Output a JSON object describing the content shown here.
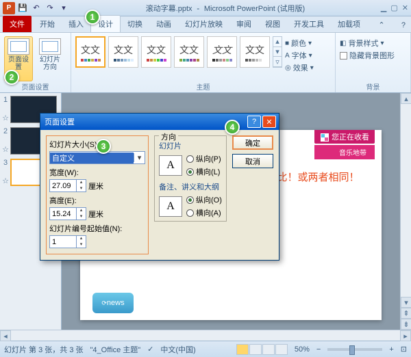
{
  "app": {
    "title_doc": "滚动字幕.pptx",
    "title_app": "Microsoft PowerPoint (试用版)"
  },
  "ribbon": {
    "tabs": {
      "file": "文件",
      "home": "开始",
      "insert": "插入",
      "design": "设计",
      "transitions": "切换",
      "animations": "动画",
      "slideshow": "幻灯片放映",
      "review": "审阅",
      "view": "视图",
      "developer": "开发工具",
      "addins": "加载项"
    },
    "groups": {
      "page_setup": "页面设置",
      "themes": "主题",
      "background": "背景"
    },
    "page_setup_btn": "页面设置",
    "orientation_btn": "幻灯片方向",
    "theme_aa": "文文",
    "colors": "颜色",
    "fonts": "字体",
    "effects": "效果",
    "bg_styles": "背景样式",
    "hide_bg": "隐藏背景图形"
  },
  "thumbs": {
    "n1": "1",
    "n2": "2",
    "n3": "3",
    "star": "☆"
  },
  "slide": {
    "text": "幻灯片大小与将要插入的视频尺寸成正比！或两者相同！",
    "logo": "news",
    "badge_top": "您正在收看",
    "badge_bot": "音乐地带"
  },
  "status": {
    "slide_info": "幻灯片 第 3 张，共 3 张",
    "theme": "\"4_Office 主题\"",
    "lang": "中文(中国)",
    "zoom": "50%"
  },
  "dialog": {
    "title": "页面设置",
    "ok": "确定",
    "cancel": "取消",
    "size_label": "幻灯片大小(S):",
    "size_value": "自定义",
    "width_label": "宽度(W):",
    "width_value": "27.09",
    "unit": "厘米",
    "height_label": "高度(E):",
    "height_value": "15.24",
    "start_label": "幻灯片编号起始值(N):",
    "start_value": "1",
    "direction_legend": "方向",
    "slides_legend": "幻灯片",
    "notes_legend": "备注、讲义和大纲",
    "portrait": "纵向(P)",
    "landscape": "横向(L)",
    "portrait2": "纵向(O)",
    "landscape2": "横向(A)",
    "icon_a": "A"
  },
  "markers": {
    "m1": "1",
    "m2": "2",
    "m3": "3",
    "m4": "4"
  }
}
